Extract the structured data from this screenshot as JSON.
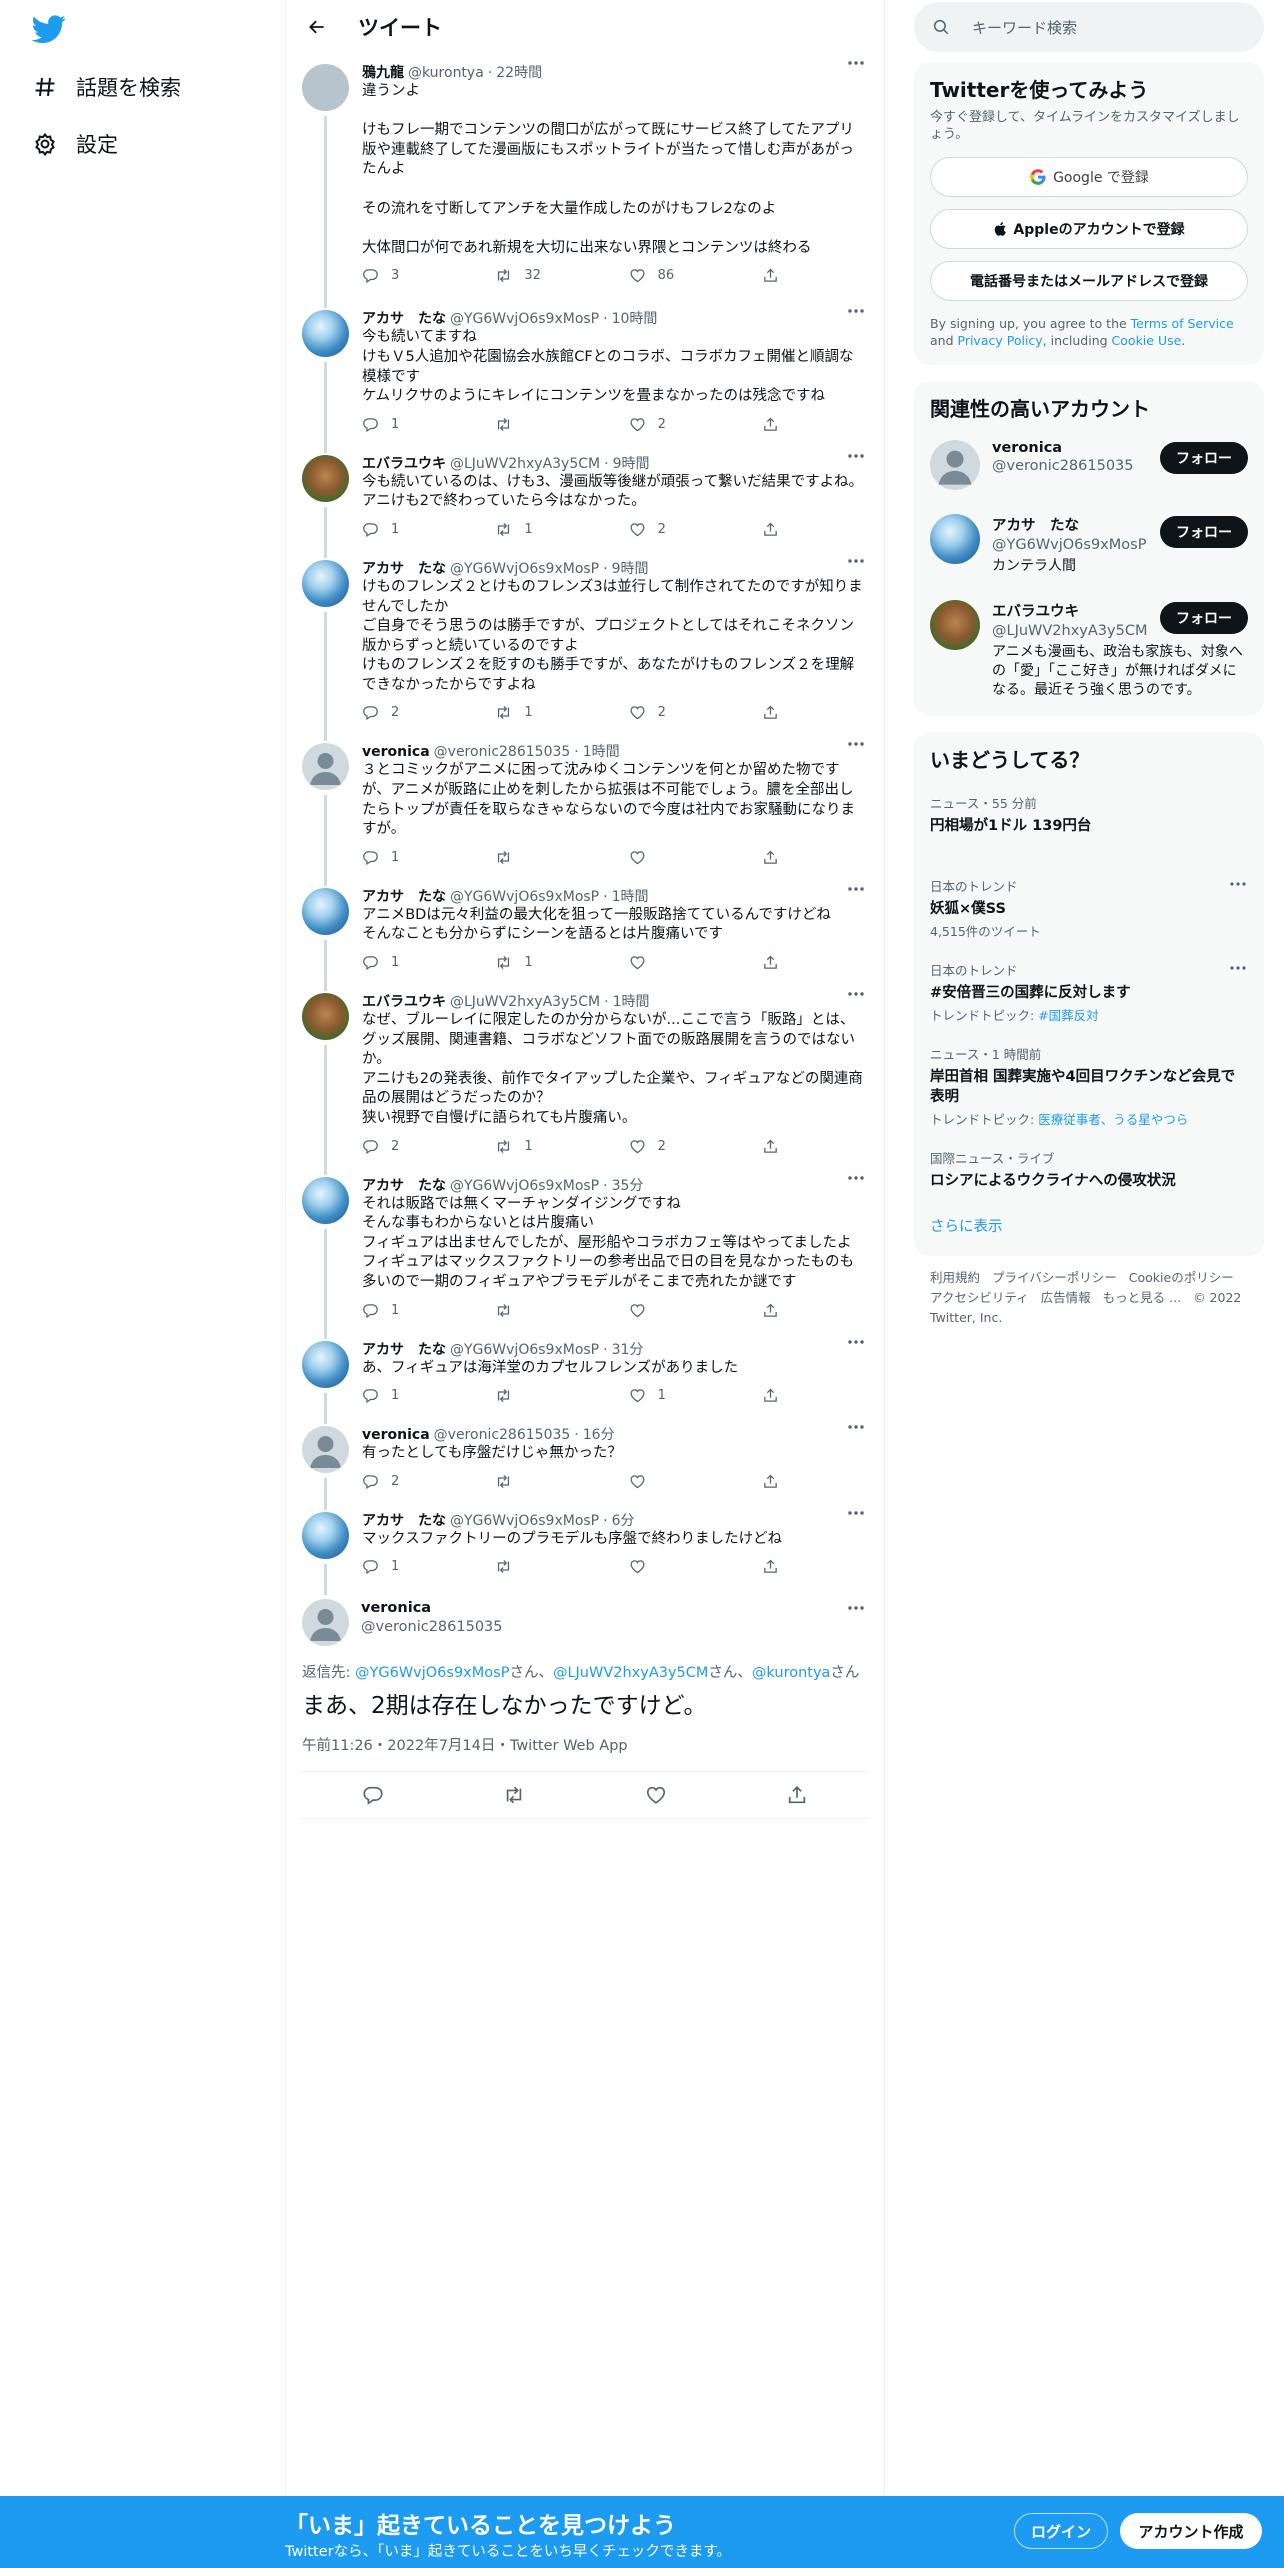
{
  "nav": {
    "explore_label": "話題を検索",
    "settings_label": "設定"
  },
  "header": {
    "title": "ツイート"
  },
  "tweets": [
    {
      "name": "鴉九龍",
      "handle": "@kurontya",
      "time": "22時間",
      "text": "違うンよ\n\nけもフレ一期でコンテンツの間口が広がって既にサービス終了してたアプリ版や連載終了してた漫画版にもスポットライトが当たって惜しむ声があがったんよ\n\nその流れを寸断してアンチを大量作成したのがけもフレ2なのよ\n\n大体間口が何であれ新規を大切に出来ない界隈とコンテンツは終わる",
      "replies": "3",
      "retweets": "32",
      "likes": "86"
    },
    {
      "name": "アカサ　たな",
      "handle": "@YG6WvjO6s9xMosP",
      "time": "10時間",
      "text": "今も続いてますね\nけもＶ5人追加や花園協会水族館CFとのコラボ、コラボカフェ開催と順調な模様です\nケムリクサのようにキレイにコンテンツを畳まなかったのは残念ですね",
      "replies": "1",
      "retweets": "",
      "likes": "2"
    },
    {
      "name": "エバラユウキ",
      "handle": "@LJuWV2hxyA3y5CM",
      "time": "9時間",
      "text": "今も続いているのは、けも3、漫画版等後継が頑張って繋いだ結果ですよね。\nアニけも2で終わっていたら今はなかった。",
      "replies": "1",
      "retweets": "1",
      "likes": "2"
    },
    {
      "name": "アカサ　たな",
      "handle": "@YG6WvjO6s9xMosP",
      "time": "9時間",
      "text": "けものフレンズ２とけものフレンズ3は並行して制作されてたのですが知りませんでしたか\nご自身でそう思うのは勝手ですが、プロジェクトとしてはそれこそネクソン版からずっと続いているのですよ\nけものフレンズ２を貶すのも勝手ですが、あなたがけものフレンズ２を理解できなかったからですよね",
      "replies": "2",
      "retweets": "1",
      "likes": "2"
    },
    {
      "name": "veronica",
      "handle": "@veronic28615035",
      "time": "1時間",
      "text": "３とコミックがアニメに困って沈みゆくコンテンツを何とか留めた物ですが、アニメが販路に止めを刺したから拡張は不可能でしょう。膿を全部出したらトップが責任を取らなきゃならないので今度は社内でお家騒動になりますが。",
      "replies": "1",
      "retweets": "",
      "likes": ""
    },
    {
      "name": "アカサ　たな",
      "handle": "@YG6WvjO6s9xMosP",
      "time": "1時間",
      "text": "アニメBDは元々利益の最大化を狙って一般販路捨てているんですけどね\nそんなことも分からずにシーンを語るとは片腹痛いです",
      "replies": "1",
      "retweets": "1",
      "likes": ""
    },
    {
      "name": "エバラユウキ",
      "handle": "@LJuWV2hxyA3y5CM",
      "time": "1時間",
      "text": "なぜ、ブルーレイに限定したのか分からないが...ここで言う「販路」とは、グッズ展開、関連書籍、コラボなどソフト面での販路展開を言うのではないか。\nアニけも2の発表後、前作でタイアップした企業や、フィギュアなどの関連商品の展開はどうだったのか？\n狭い視野で自慢げに語られても片腹痛い。",
      "replies": "2",
      "retweets": "1",
      "likes": "2"
    },
    {
      "name": "アカサ　たな",
      "handle": "@YG6WvjO6s9xMosP",
      "time": "35分",
      "text": "それは販路では無くマーチャンダイジングですね\nそんな事もわからないとは片腹痛い\nフィギュアは出ませんでしたが、屋形船やコラボカフェ等はやってましたよ\nフィギュアはマックスファクトリーの参考出品で日の目を見なかったものも多いので一期のフィギュアやプラモデルがそこまで売れたか謎です",
      "replies": "1",
      "retweets": "",
      "likes": ""
    },
    {
      "name": "アカサ　たな",
      "handle": "@YG6WvjO6s9xMosP",
      "time": "31分",
      "text": "あ、フィギュアは海洋堂のカプセルフレンズがありました",
      "replies": "1",
      "retweets": "",
      "likes": "1"
    },
    {
      "name": "veronica",
      "handle": "@veronic28615035",
      "time": "16分",
      "text": "有ったとしても序盤だけじゃ無かった？",
      "replies": "2",
      "retweets": "",
      "likes": ""
    },
    {
      "name": "アカサ　たな",
      "handle": "@YG6WvjO6s9xMosP",
      "time": "6分",
      "text": "マックスファクトリーのプラモデルも序盤で終わりましたけどね",
      "replies": "1",
      "retweets": "",
      "likes": ""
    }
  ],
  "main_tweet": {
    "name": "veronica",
    "handle": "@veronic28615035",
    "replying_prefix": "返信先: ",
    "replying_to": [
      "@YG6WvjO6s9xMosP",
      "@LJuWV2hxyA3y5CM",
      "@kurontya"
    ],
    "san": "さん",
    "sep": "、",
    "text": "まあ、2期は存在しなかったですけど。",
    "meta": "午前11:26・2022年7月14日・Twitter Web App"
  },
  "search": {
    "placeholder": "キーワード検索"
  },
  "signup": {
    "title": "Twitterを使ってみよう",
    "subtitle": "今すぐ登録して、タイムラインをカスタマイズしましょう。",
    "google_label": "Google で登録",
    "apple_label": "Appleのアカウントで登録",
    "phone_label": "電話番号またはメールアドレスで登録",
    "terms_prefix": "By signing up, you agree to the ",
    "terms_link": "Terms of Service",
    "terms_and": " and ",
    "privacy_link": "Privacy Policy",
    "terms_including": ", including ",
    "cookie_link": "Cookie Use",
    "terms_end": "."
  },
  "relevant": {
    "title": "関連性の高いアカウント",
    "follow_label": "フォロー",
    "accounts": [
      {
        "name": "veronica",
        "handle": "@veronic28615035",
        "bio": ""
      },
      {
        "name": "アカサ　たな",
        "handle": "@YG6WvjO6s9xMosP",
        "bio": "カンテラ人間"
      },
      {
        "name": "エバラユウキ",
        "handle": "@LJuWV2hxyA3y5CM",
        "bio": "アニメも漫画も、政治も家族も、対象への「愛」「ここ好き」が無ければダメになる。最近そう強く思うのです。"
      }
    ]
  },
  "trends": {
    "title": "いまどうしてる？",
    "items": [
      {
        "context": "ニュース・55 分前",
        "title": "円相場が1ドル 139円台",
        "sub": "",
        "link": ""
      },
      {
        "context": "日本のトレンド",
        "title": "妖狐×僕SS",
        "sub": "4,515件のツイート",
        "link": ""
      },
      {
        "context": "日本のトレンド",
        "title": "#安倍晋三の国葬に反対します",
        "sub": "トレンドトピック: ",
        "link": "#国葬反対"
      },
      {
        "context": "ニュース・1 時間前",
        "title": "岸田首相 国葬実施や4回目ワクチンなど会見で表明",
        "sub": "トレンドトピック: ",
        "link": "医療従事者、うる星やつら"
      },
      {
        "context": "国際ニュース・ライブ",
        "title": "ロシアによるウクライナへの侵攻状況",
        "sub": "",
        "link": ""
      }
    ],
    "show_more": "さらに表示"
  },
  "footer": {
    "links": [
      "利用規約",
      "プライバシーポリシー",
      "Cookieのポリシー",
      "アクセシビリティ",
      "広告情報",
      "もっと見る ...",
      "© 2022 Twitter, Inc."
    ]
  },
  "bottom_bar": {
    "title": "「いま」起きていることを見つけよう",
    "subtitle": "Twitterなら、「いま」起きていることをいち早くチェックできます。",
    "login_label": "ログイン",
    "signup_label": "アカウント作成"
  },
  "colors": {
    "accent": "#1d9bf0",
    "text": "#0f1419",
    "muted": "#536471"
  }
}
